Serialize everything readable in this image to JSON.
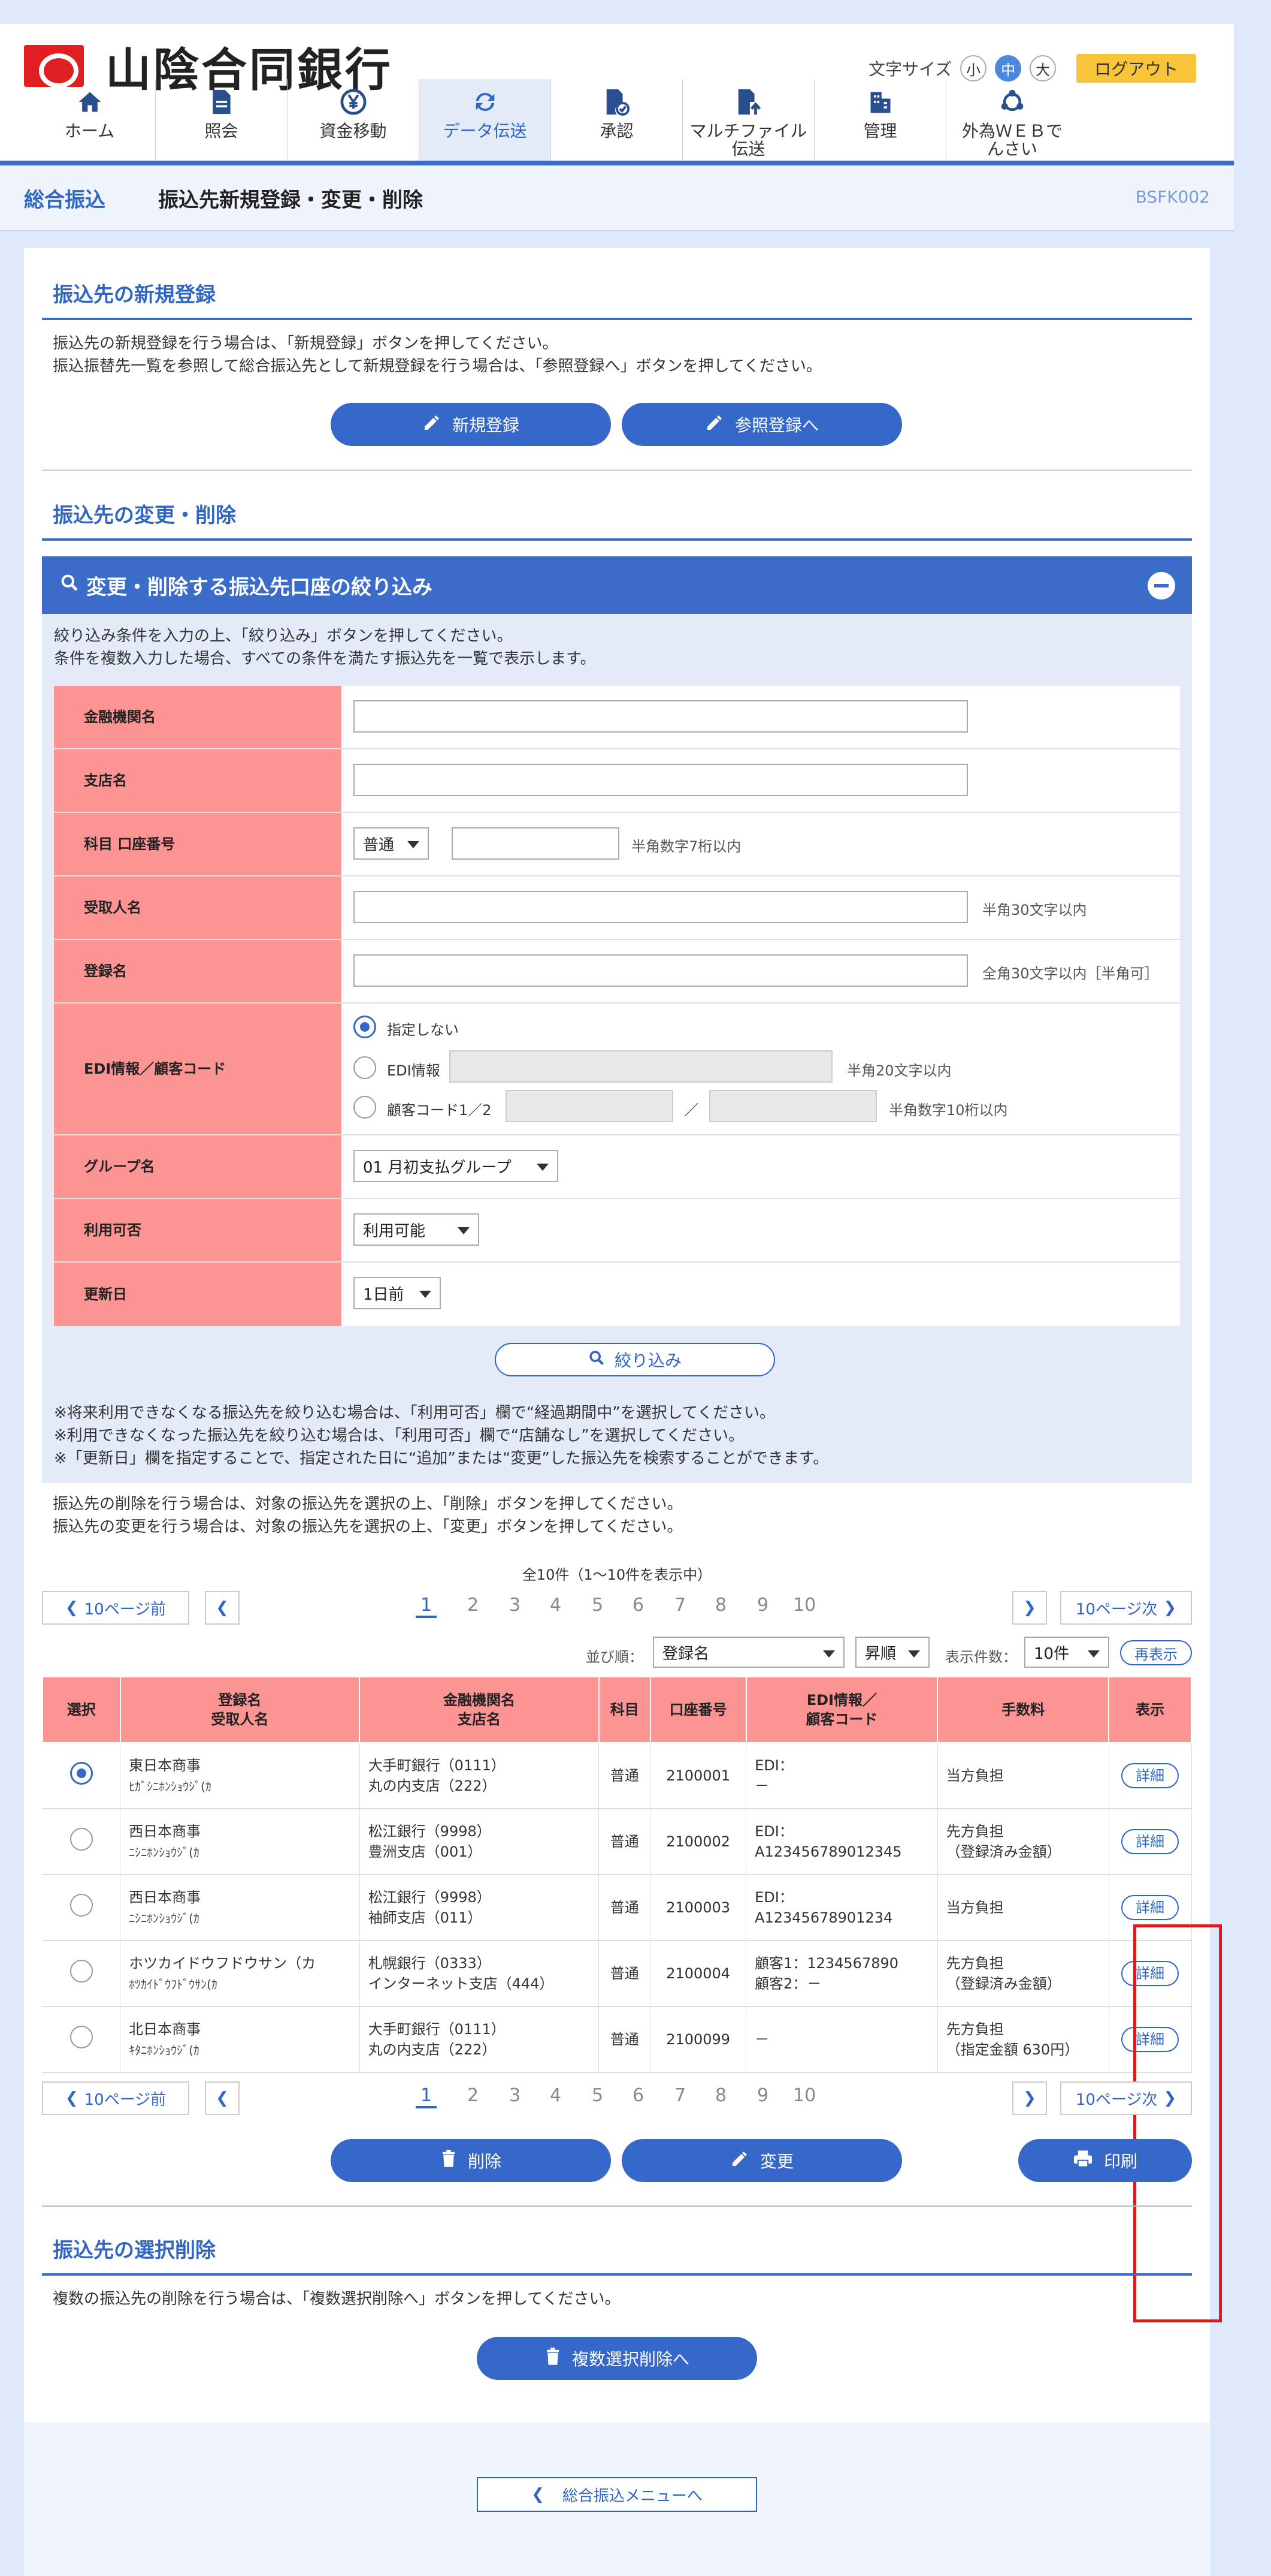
{
  "header": {
    "bank_name": "山陰合同銀行",
    "font_size_label": "文字サイズ",
    "font_small": "小",
    "font_medium": "中",
    "font_large": "大",
    "logout": "ログアウト"
  },
  "nav": [
    {
      "label": "ホーム",
      "icon": "home-icon"
    },
    {
      "label": "照会",
      "icon": "document-icon"
    },
    {
      "label": "資金移動",
      "icon": "yen-transfer-icon"
    },
    {
      "label": "データ伝送",
      "icon": "refresh-icon"
    },
    {
      "label": "承認",
      "icon": "approval-icon"
    },
    {
      "label": "マルチファイル伝送",
      "icon": "file-upload-icon"
    },
    {
      "label": "管理",
      "icon": "building-icon"
    },
    {
      "label": "外為ＷＥＢでんさい",
      "icon": "network-icon"
    }
  ],
  "title_bar": {
    "category": "総合振込",
    "title": "振込先新規登録・変更・削除",
    "code": "BSFK002"
  },
  "section_new": {
    "title": "振込先の新規登録",
    "line1": "振込先の新規登録を行う場合は、「新規登録」ボタンを押してください。",
    "line2": "振込振替先一覧を参照して総合振込先として新規登録を行う場合は、「参照登録へ」ボタンを押してください。",
    "new_button": "新規登録",
    "ref_button": "参照登録へ"
  },
  "section_change": {
    "title": "振込先の変更・削除"
  },
  "filter": {
    "title": "変更・削除する振込先口座の絞り込み",
    "desc1": "絞り込み条件を入力の上、「絞り込み」ボタンを押してください。",
    "desc2": "条件を複数入力した場合、すべての条件を満たす振込先を一覧で表示します。",
    "labels": {
      "bank": "金融機関名",
      "branch": "支店名",
      "account": "科目 口座番号",
      "payee": "受取人名",
      "reg_name": "登録名",
      "edi_1": "EDI情報／",
      "edi_2": "顧客コード",
      "group": "グループ名",
      "usable": "利用可否",
      "updated": "更新日"
    },
    "account_type": "普通",
    "account_hint": "半角数字7桁以内",
    "payee_hint": "半角30文字以内",
    "reg_hint": "全角30文字以内［半角可］",
    "radio_none": "指定しない",
    "radio_edi": "EDI情報",
    "edi_hint": "半角20文字以内",
    "radio_customer": "顧客コード1／2",
    "slash": "／",
    "customer_hint": "半角数字10桁以内",
    "group_value": "01 月初支払グループ",
    "usable_value": "利用可能",
    "updated_value": "1日前",
    "filter_button": "絞り込み",
    "note1": "※将来利用できなくなる振込先を絞り込む場合は、「利用可否」欄で“経過期間中”を選択してください。",
    "note2": "※利用できなくなった振込先を絞り込む場合は、「利用可否」欄で“店舗なし”を選択してください。",
    "note3": "※「更新日」欄を指定することで、指定された日に“追加”または“変更”した振込先を検索することができます。"
  },
  "list_desc": {
    "line1": "振込先の削除を行う場合は、対象の振込先を選択の上、「削除」ボタンを押してください。",
    "line2": "振込先の変更を行う場合は、対象の振込先を選択の上、「変更」ボタンを押してください。"
  },
  "pager": {
    "summary": "全10件（1～10件を表示中）",
    "prev10": "10ページ前",
    "next10": "10ページ次",
    "pages": [
      "1",
      "2",
      "3",
      "4",
      "5",
      "6",
      "7",
      "8",
      "9",
      "10"
    ]
  },
  "sort": {
    "label": "並び順：",
    "field": "登録名",
    "order": "昇順",
    "count_label": "表示件数：",
    "count": "10件",
    "refresh": "再表示"
  },
  "table": {
    "headers": {
      "select": "選択",
      "name1": "登録名",
      "name2": "受取人名",
      "bank1": "金融機関名",
      "bank2": "支店名",
      "type": "科目",
      "account": "口座番号",
      "edi1": "EDI情報／",
      "edi2": "顧客コード",
      "fee": "手数料",
      "show": "表示"
    },
    "detail_label": "詳細",
    "rows": [
      {
        "checked": true,
        "name": "東日本商事",
        "kana": "ﾋｶﾞｼﾆﾎﾝｼｮｳｼﾞ(ｶ",
        "bank": "大手町銀行（0111）",
        "branch": "丸の内支店（222）",
        "type": "普通",
        "account": "2100001",
        "edi1": "EDI：",
        "edi2": "－",
        "fee1": "当方負担",
        "fee2": ""
      },
      {
        "checked": false,
        "name": "西日本商事",
        "kana": "ﾆｼﾆﾎﾝｼｮｳｼﾞ(ｶ",
        "bank": "松江銀行（9998）",
        "branch": "豊洲支店（001）",
        "type": "普通",
        "account": "2100002",
        "edi1": "EDI：",
        "edi2": "A123456789012345",
        "fee1": "先方負担",
        "fee2": "（登録済み金額）"
      },
      {
        "checked": false,
        "name": "西日本商事",
        "kana": "ﾆｼﾆﾎﾝｼｮｳｼﾞ(ｶ",
        "bank": "松江銀行（9998）",
        "branch": "袖師支店（011）",
        "type": "普通",
        "account": "2100003",
        "edi1": "EDI：",
        "edi2": "A12345678901234",
        "fee1": "当方負担",
        "fee2": ""
      },
      {
        "checked": false,
        "name": "ホツカイドウフドウサン（カ",
        "kana": "ﾎﾂｶｲﾄﾞｳﾌﾄﾞｳｻﾝ(ｶ",
        "bank": "札幌銀行（0333）",
        "branch": "インターネット支店（444）",
        "type": "普通",
        "account": "2100004",
        "edi1": "顧客1：1234567890",
        "edi2": "顧客2：－",
        "fee1": "先方負担",
        "fee2": "（登録済み金額）"
      },
      {
        "checked": false,
        "name": "北日本商事",
        "kana": "ｷﾀﾆﾎﾝｼｮｳｼﾞ(ｶ",
        "bank": "大手町銀行（0111）",
        "branch": "丸の内支店（222）",
        "type": "普通",
        "account": "2100099",
        "edi1": "－",
        "edi2": "",
        "fee1": "先方負担",
        "fee2": "（指定金額 630円）"
      }
    ]
  },
  "actions": {
    "delete": "削除",
    "change": "変更",
    "print": "印刷"
  },
  "section_multi": {
    "title": "振込先の選択削除",
    "desc": "複数の振込先の削除を行う場合は、「複数選択削除へ」ボタンを押してください。",
    "button": "複数選択削除へ"
  },
  "back_button": "総合振込メニューへ",
  "colors": {
    "primary": "#3568c8",
    "header_red": "#fd9494",
    "panel": "#e3ebf8",
    "highlight": "#e01a1a"
  }
}
